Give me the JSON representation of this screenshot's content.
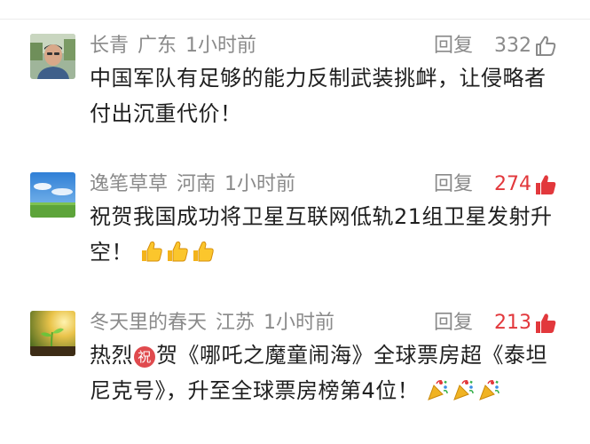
{
  "comments": [
    {
      "username": "长青",
      "location": "广东",
      "time": "1小时前",
      "reply_label": "回复",
      "likes": "332",
      "liked": false,
      "text_lines": [
        "中国军队有足够的能力反制武装挑衅，让侵略者",
        "付出沉重代价！"
      ],
      "avatar_icon": "person-portrait",
      "emoji_icon": ""
    },
    {
      "username": "逸笔草草",
      "location": "河南",
      "time": "1小时前",
      "reply_label": "回复",
      "likes": "274",
      "liked": true,
      "text_lines": [
        "祝贺我国成功将卫星互联网低轨21组卫星发射升",
        "空！"
      ],
      "avatar_icon": "sky-meadow",
      "emoji_icon": "thumbs-up-emoji"
    },
    {
      "username": "冬天里的春天",
      "location": "江苏",
      "time": "1小时前",
      "reply_label": "回复",
      "likes": "213",
      "liked": true,
      "text_before_badge": "热烈",
      "badge": "祝",
      "text_after_badge": "贺《哪吒之魔童闹海》全球票房超《泰坦",
      "text_line2": "尼克号》，升至全球票房榜第4位！",
      "avatar_icon": "sprout-sunlight",
      "emoji_icon": "party-popper-emoji"
    }
  ],
  "colors": {
    "meta_gray": "#8a8a8a",
    "like_red": "#e2383c",
    "text": "#1f1f1f"
  }
}
